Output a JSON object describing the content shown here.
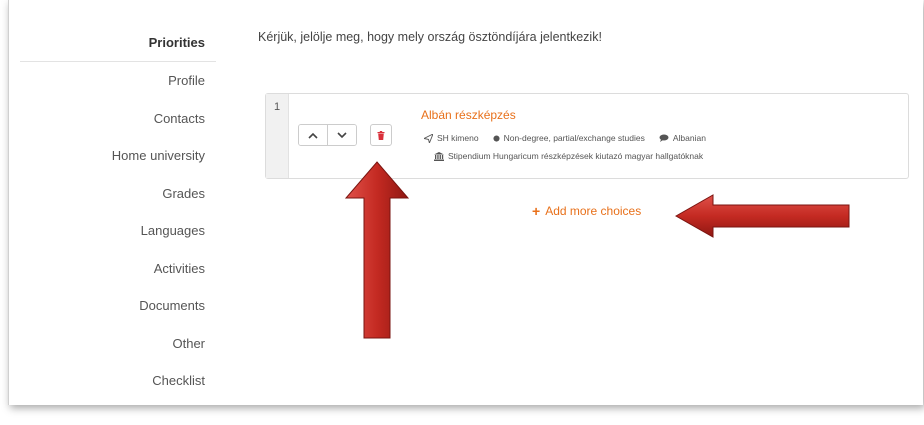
{
  "sidebar": {
    "items": [
      {
        "label": "Priorities",
        "active": true
      },
      {
        "label": "Profile"
      },
      {
        "label": "Contacts"
      },
      {
        "label": "Home university"
      },
      {
        "label": "Grades"
      },
      {
        "label": "Languages"
      },
      {
        "label": "Activities"
      },
      {
        "label": "Documents"
      },
      {
        "label": "Other"
      },
      {
        "label": "Checklist"
      }
    ]
  },
  "main": {
    "intro": "Kérjük, jelölje meg, hogy mely ország ösztöndíjára jelentkezik!",
    "choices": [
      {
        "number": "1",
        "title": "Albán részképzés",
        "program": "SH kimeno",
        "study_type": "Non-degree, partial/exchange studies",
        "language": "Albanian",
        "scholarship": "Stipendium Hungaricum részképzések kiutazó magyar hallgatóknak"
      }
    ],
    "add_more_label": "Add more choices"
  },
  "colors": {
    "accent_orange": "#e8701a",
    "delete_red": "#d9303a",
    "arrow_red": "#c42a22"
  },
  "icons": {
    "up": "chevron-up-icon",
    "down": "chevron-down-icon",
    "delete": "trash-icon",
    "program": "paper-plane-icon",
    "study_type": "circle-icon",
    "language": "speech-bubble-icon",
    "scholarship": "institution-icon",
    "add": "plus-icon"
  }
}
